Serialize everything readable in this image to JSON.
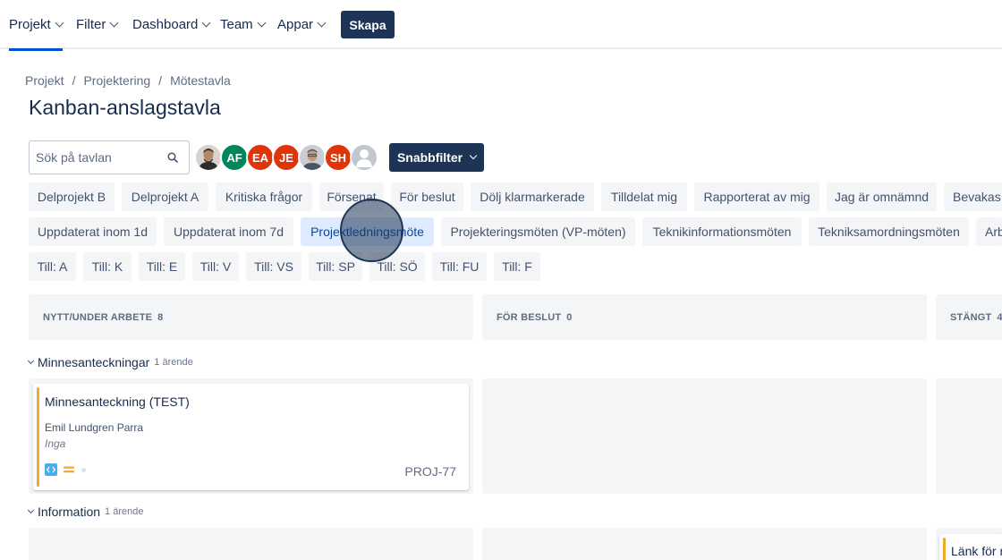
{
  "nav": {
    "items": [
      {
        "label": "Projekt",
        "active": true
      },
      {
        "label": "Filter",
        "active": false
      },
      {
        "label": "Dashboard",
        "active": false
      },
      {
        "label": "Team",
        "active": false
      },
      {
        "label": "Appar",
        "active": false
      }
    ],
    "create_label": "Skapa"
  },
  "breadcrumb": [
    "Projekt",
    "Projektering",
    "Mötestavla"
  ],
  "page_title": "Kanban-anslagstavla",
  "toolbar": {
    "search_placeholder": "Sök på tavlan",
    "avatars": [
      {
        "initials": "",
        "kind": "photo",
        "color": "#6b5a4e"
      },
      {
        "initials": "AF",
        "kind": "initials",
        "color": "#00875a"
      },
      {
        "initials": "EA",
        "kind": "initials",
        "color": "#de350b"
      },
      {
        "initials": "JE",
        "kind": "initials",
        "color": "#de350b"
      },
      {
        "initials": "",
        "kind": "photo",
        "color": "#7a8390"
      },
      {
        "initials": "SH",
        "kind": "initials",
        "color": "#de350b"
      },
      {
        "initials": "",
        "kind": "placeholder",
        "color": "#c1c7d0"
      }
    ],
    "quickfilter_label": "Snabbfilter"
  },
  "filters": {
    "row1": [
      "Delprojekt B",
      "Delprojekt A",
      "Kritiska frågor",
      "Försenat",
      "För beslut",
      "Dölj klarmarkerade",
      "Tilldelat mig",
      "Rapporterat av mig",
      "Jag är omnämnd",
      "Bevakas av mig"
    ],
    "row2": [
      "Uppdaterat inom 1d",
      "Uppdaterat inom 7d",
      "Projektledningsmöte",
      "Projekteringsmöten (VP-möten)",
      "Teknikinformationsmöten",
      "Tekniksamordningsmöten",
      "Arbetsmöten"
    ],
    "row3": [
      "Till: A",
      "Till: K",
      "Till: E",
      "Till: V",
      "Till: VS",
      "Till: SP",
      "Till: SÖ",
      "Till: FU",
      "Till: F"
    ],
    "selected": "Projektledningsmöte"
  },
  "columns": [
    {
      "name": "NYTT/UNDER ARBETE",
      "count": "8"
    },
    {
      "name": "FÖR BESLUT",
      "count": "0"
    },
    {
      "name": "STÄNGT",
      "count": "4"
    }
  ],
  "swimlanes": [
    {
      "name": "Minnesanteckningar",
      "count_label": "1 ärende",
      "card": {
        "summary": "Minnesanteckning (TEST)",
        "assignee": "Emil Lundgren Parra",
        "sub": "Inga",
        "key": "PROJ-77",
        "type_icon": "code-icon",
        "priority_icon": "medium-priority-icon"
      }
    },
    {
      "name": "Information",
      "count_label": "1 ärende",
      "card": {
        "summary": "Länk för mötet"
      }
    }
  ]
}
